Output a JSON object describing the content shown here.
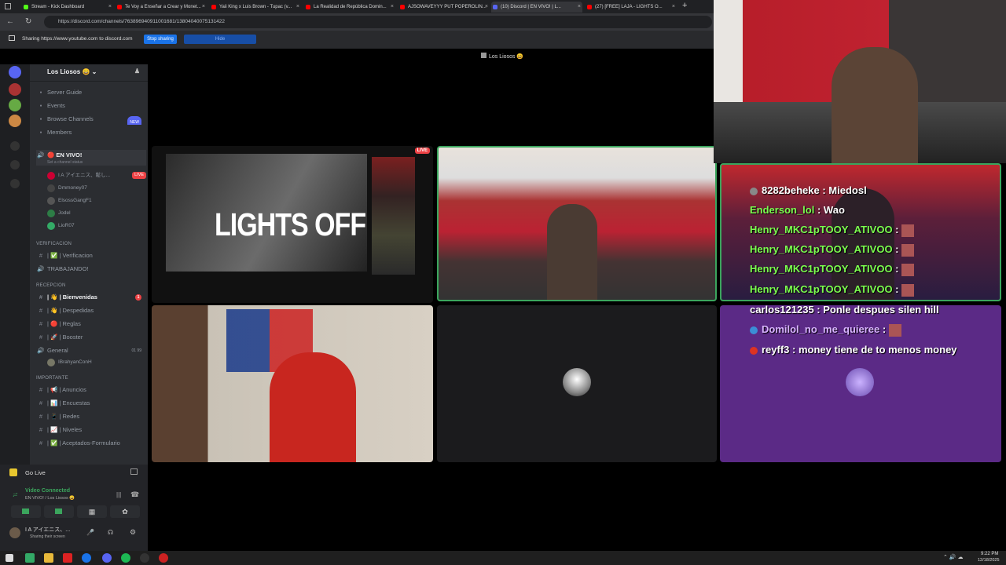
{
  "browser": {
    "tabs": [
      {
        "label": "Stream - Kick Dashboard",
        "color": "#53fc18"
      },
      {
        "label": "Te Voy a Enseñar a Crear y Monet...",
        "color": "#ff0000"
      },
      {
        "label": "Yaii King x Luis Brown - Tupac (v...",
        "color": "#ff0000"
      },
      {
        "label": "La Realidad de República Domin...",
        "color": "#ff0000"
      },
      {
        "label": "AJSOWAVEYYY PUT POPEROLIN...",
        "color": "#ff0000"
      },
      {
        "label": "(10) Discord | EN VIVO! | L...",
        "color": "#5865f2"
      },
      {
        "label": "(27) [FREE] LAJA - LIGHTS O...",
        "color": "#ff0000"
      }
    ],
    "url": "https://discord.com/channels/763896940911001681/13804040075131422",
    "share_text": "Sharing https://www.youtube.com to discord.com",
    "stop_sharing": "Stop sharing",
    "hide": "Hide"
  },
  "discord": {
    "call_title": "Los Liosos 😄",
    "guild_name": "Los Liosos 😄",
    "nav": [
      {
        "icon": "book-icon",
        "label": "Server Guide"
      },
      {
        "icon": "calendar-icon",
        "label": "Events"
      },
      {
        "icon": "browse-icon",
        "label": "Browse Channels",
        "badge": "NEW"
      },
      {
        "icon": "members-icon",
        "label": "Members"
      }
    ],
    "voice_channel": {
      "label": "🔴 EN VIVO!",
      "status": "Set a channel status"
    },
    "voice_users": [
      {
        "name": "I A アイエニス、鬆し...",
        "live": "LIVE",
        "color": "#c03"
      },
      {
        "name": "Dmmoney07",
        "color": "#444"
      },
      {
        "name": "ElsossGangF1",
        "color": "#555"
      },
      {
        "name": "Jodel",
        "color": "#2d7d46"
      },
      {
        "name": "LioR07",
        "color": "#3a6"
      }
    ],
    "categories": [
      {
        "label": "VERIFICACION",
        "channels": [
          {
            "icon": "#",
            "label": "| ✅ | Verificacion"
          },
          {
            "icon": "🔊",
            "label": "TRABAJANDO!"
          }
        ]
      },
      {
        "label": "RECEPCION",
        "channels": [
          {
            "icon": "#",
            "label": "| 👋 | Bienvenidas",
            "bold": true,
            "mention": "1"
          },
          {
            "icon": "#",
            "label": "| 👋 | Despedidas"
          },
          {
            "icon": "#",
            "label": "| 🔴 | Reglas"
          },
          {
            "icon": "#",
            "label": "| 🚀 | Booster"
          },
          {
            "icon": "🔊",
            "label": "General",
            "count": "01  99"
          }
        ]
      },
      {
        "label": "IMPORTANTE",
        "channels": [
          {
            "icon": "#",
            "label": "| 📢 | Anuncios"
          },
          {
            "icon": "#",
            "label": "| 📊 | Encuestas"
          },
          {
            "icon": "#",
            "label": "| 📱 | Redes"
          },
          {
            "icon": "#",
            "label": "| 📈 | Niveles"
          },
          {
            "icon": "#",
            "label": "| ✅ | Aceptados-Formulario"
          }
        ]
      }
    ],
    "general_user": "IBrahyanConH",
    "go_live": "Go Live",
    "voice_status": "Video Connected",
    "voice_sub": "EN VIVO! / Los Liosos 😄",
    "me_name": "I A アイエニス、...",
    "me_status": "Sharing their screen"
  },
  "tiles": {
    "yt_title": "LIGHTS OFF",
    "yt_live": "LIVE"
  },
  "chat": [
    {
      "user": "8282beheke",
      "msg": "Miedosl",
      "color": "#ffffff",
      "badge": "#888"
    },
    {
      "user": "Enderson_lol",
      "msg": "Wao",
      "color": "#7cff4f"
    },
    {
      "user": "Henry_MKC1pTOOY_ATIVOO",
      "msg": "",
      "color": "#7cff4f"
    },
    {
      "user": "Henry_MKC1pTOOY_ATIVOO",
      "msg": "",
      "color": "#7cff4f"
    },
    {
      "user": "Henry_MKC1pTOOY_ATIVOO",
      "msg": "",
      "color": "#7cff4f"
    },
    {
      "user": "Henry_MKC1pTOOY_ATIVOO",
      "msg": "",
      "color": "#7cff4f"
    },
    {
      "user": "carlos121235",
      "msg": "Ponle despues silen hill",
      "color": "#ffffff"
    },
    {
      "user": "Domilol_no_me_quieree",
      "msg": "",
      "color": "#d8b4ff",
      "badge": "#3b8ed6"
    },
    {
      "user": "reyff3",
      "msg": "money tiene de to menos money",
      "color": "#ffffff",
      "badge": "#d32"
    }
  ],
  "taskbar": {
    "time": "9:22 PM",
    "date": "12/18/2025"
  }
}
